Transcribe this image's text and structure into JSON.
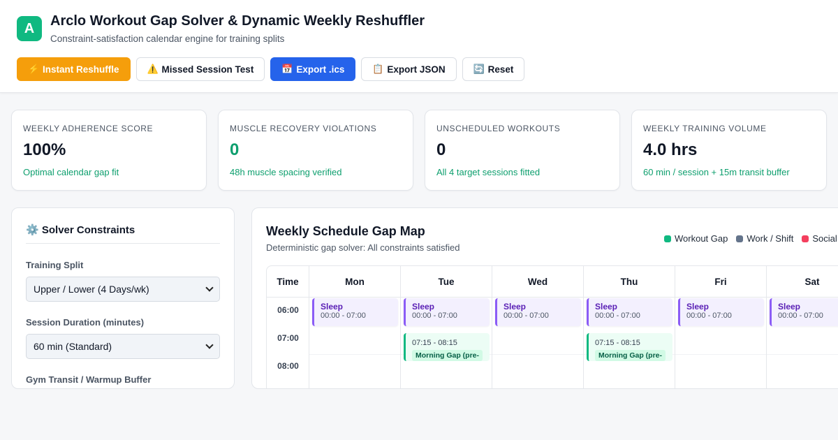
{
  "app": {
    "logo_letter": "A",
    "title": "Arclo Workout Gap Solver & Dynamic Weekly Reshuffler",
    "subtitle": "Constraint-satisfaction calendar engine for training splits"
  },
  "toolbar": {
    "buttons": [
      {
        "icon": "⚡",
        "label": "Instant Reshuffle"
      },
      {
        "icon": "⚠️",
        "label": "Missed Session Test"
      },
      {
        "icon": "📅",
        "label": "Export .ics"
      },
      {
        "icon": "📋",
        "label": "Export JSON"
      },
      {
        "icon": "🔄",
        "label": "Reset"
      }
    ]
  },
  "stats": [
    {
      "label": "WEEKLY ADHERENCE SCORE",
      "value": "100%",
      "note": "Optimal calendar gap fit"
    },
    {
      "label": "MUSCLE RECOVERY VIOLATIONS",
      "value": "0",
      "note": "48h muscle spacing verified"
    },
    {
      "label": "UNSCHEDULED WORKOUTS",
      "value": "0",
      "note": "All 4 target sessions fitted"
    },
    {
      "label": "WEEKLY TRAINING VOLUME",
      "value": "4.0 hrs",
      "note": "60 min / session + 15m transit buffer"
    }
  ],
  "constraints": {
    "icon": "⚙️",
    "title": "Solver Constraints",
    "fields": [
      {
        "label": "Training Split",
        "value": "Upper / Lower (4 Days/wk)"
      },
      {
        "label": "Session Duration (minutes)",
        "value": "60 min (Standard)"
      },
      {
        "label": "Gym Transit / Warmup Buffer",
        "value": ""
      }
    ]
  },
  "schedule": {
    "title": "Weekly Schedule Gap Map",
    "subtitle": "Deterministic gap solver: All constraints satisfied",
    "legend": [
      {
        "label": "Workout Gap",
        "color": "#10b981"
      },
      {
        "label": "Work / Shift",
        "color": "#64748b"
      },
      {
        "label": "Social",
        "color": "#f43f5e"
      }
    ],
    "time_header": "Time",
    "times": [
      "06:00",
      "07:00",
      "08:00"
    ],
    "days": [
      "Mon",
      "Tue",
      "Wed",
      "Thu",
      "Fri",
      "Sat"
    ],
    "sleep": {
      "title": "Sleep",
      "time": "00:00 - 07:00"
    },
    "gap": {
      "time": "07:15 - 08:15",
      "tag": "Morning Gap (pre-"
    }
  }
}
